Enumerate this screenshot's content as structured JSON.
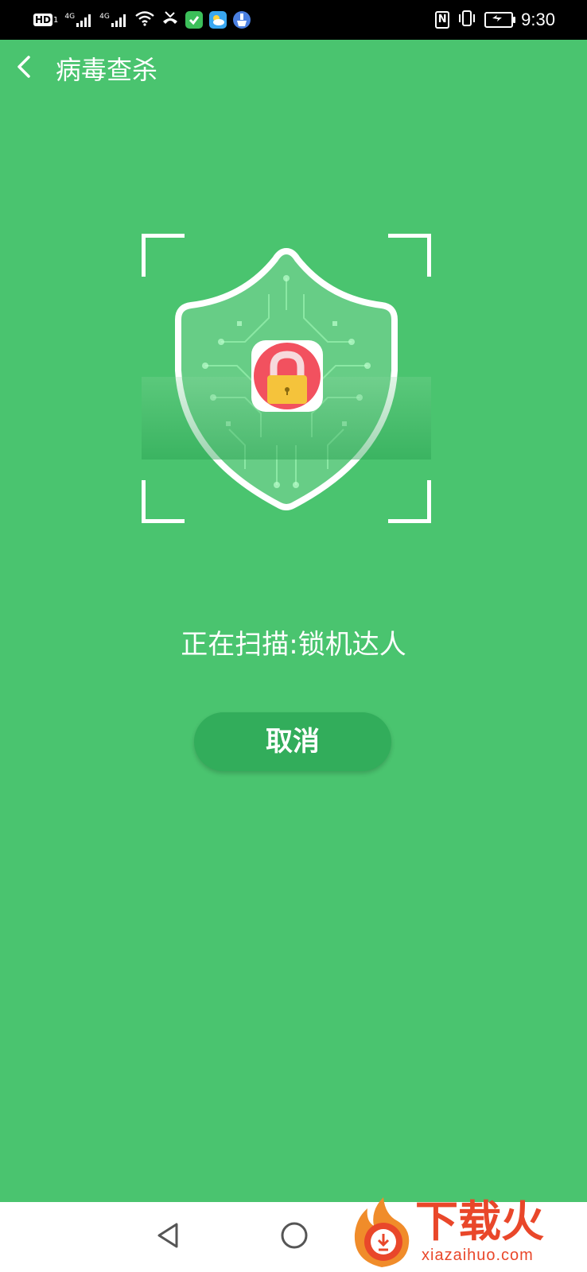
{
  "status_bar": {
    "hd_label": "HD",
    "hd_sub": "1",
    "network1": "4G",
    "network2": "4G",
    "time": "9:30",
    "nfc_label": "N",
    "icons": [
      "hd-icon",
      "signal-icon",
      "signal-icon",
      "wifi-icon",
      "missed-call-icon",
      "app-green-icon",
      "app-weather-icon",
      "app-cleaner-icon",
      "nfc-icon",
      "vibrate-icon",
      "battery-icon"
    ]
  },
  "header": {
    "title": "病毒查杀",
    "back_icon": "chevron-left-icon"
  },
  "scanner": {
    "shield_icon": "shield-circuit-icon",
    "app_icon": "lock-app-icon",
    "colors": {
      "app_bg": "#f2515f",
      "lock_body": "#f5c33b"
    }
  },
  "scan_status": "正在扫描:锁机达人",
  "cancel_label": "取消",
  "nav": {
    "icons": [
      "nav-back-icon",
      "nav-home-icon"
    ]
  },
  "watermark": {
    "text": "下载火",
    "url": "xiazaihuo.com"
  },
  "colors": {
    "background": "#4ac46f",
    "button": "#32ad5b",
    "status_bar": "#000000",
    "watermark": "#e9472a"
  }
}
